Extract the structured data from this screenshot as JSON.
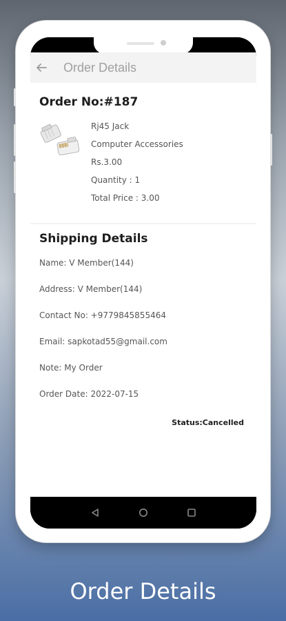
{
  "appbar": {
    "title": "Order Details"
  },
  "order": {
    "number": "Order No:#187",
    "product": {
      "name": "Rj45 Jack",
      "category": "Computer Accessories",
      "price": "Rs.3.00",
      "quantity": "Quantity : 1",
      "total": "Total Price : 3.00"
    }
  },
  "shipping": {
    "title": "Shipping Details",
    "name": "Name: V Member(144)",
    "address": "Address: V Member(144)",
    "contact": "Contact No: +9779845855464",
    "email": "Email: sapkotad55@gmail.com",
    "note": "Note: My Order",
    "date": "Order Date: 2022-07-15",
    "status": "Status:Cancelled"
  },
  "caption": "Order Details",
  "icons": {
    "back": "arrow-left-icon",
    "nav_back": "triangle-back-icon",
    "nav_home": "circle-home-icon",
    "nav_recent": "square-recent-icon",
    "product": "rj45-connector-icon"
  }
}
